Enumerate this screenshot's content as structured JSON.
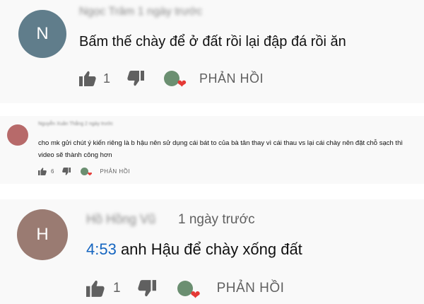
{
  "icons": {
    "like": "thumb-up-icon",
    "dislike": "thumb-down-icon",
    "creator_heart": "creator-heart-icon"
  },
  "colors": {
    "timestamp_link": "#1565c0",
    "heart": "#e53935"
  },
  "comments": [
    {
      "avatar_letter": "N",
      "author": "Ngọc Trâm",
      "time": "1 ngày trước",
      "text": "Bấm thế chày để ở đất rồi lại đập đá rồi ăn",
      "likes": "1",
      "reply_label": "PHẢN HỒI"
    },
    {
      "author": "Nguyễn Xuân Thắng",
      "time": "2 ngày trước",
      "text": "cho mk gửi chút ý kiến riêng là b hậu nên sử dụng cái bát to của bà tân thay vì cái thau vs lại cái chày nên đặt chỗ sạch thì video sẽ thành công hơn",
      "likes": "6",
      "reply_label": "PHẢN HỒI"
    },
    {
      "avatar_letter": "H",
      "author": "Hồ Hồng Vũ",
      "time": "1 ngày trước",
      "timestamp": "4:53",
      "text": " anh Hậu để chày xống đất",
      "likes": "1",
      "reply_label": "PHẢN HỒI"
    }
  ]
}
